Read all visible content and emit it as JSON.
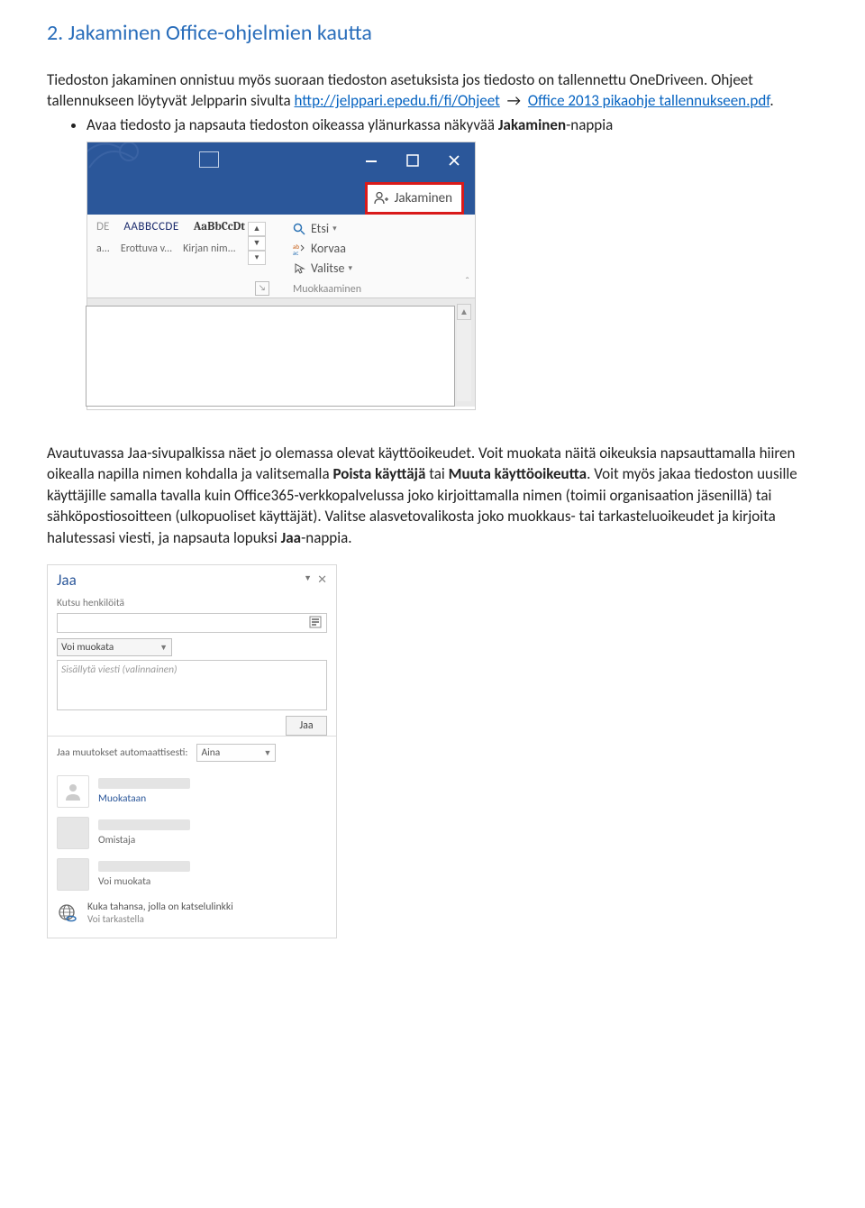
{
  "section_title": "2.  Jakaminen Office-ohjelmien kautta",
  "intro": {
    "part1": "Tiedoston jakaminen onnistuu myös suoraan tiedoston asetuksista jos tiedosto on tallennettu OneDriveen. Ohjeet tallennukseen löytyvät Jelpparin sivulta ",
    "link1": "http://jelppari.epedu.fi/fi/Ohjeet",
    "arrow": "→",
    "link2": "Office 2013 pikaohje tallennukseen.pdf",
    "part2": "."
  },
  "bullet1": {
    "t1": "Avaa tiedosto ja napsauta tiedoston oikeassa ylänurkassa näkyvää ",
    "b1": "Jakaminen",
    "t2": "-nappia"
  },
  "shot1": {
    "share_label": "Jakaminen",
    "style1_preview": "AABBCCDE",
    "style1_frag": "DE",
    "style2_preview": "AaBbCcDt",
    "style1_name": "Erottuva v...",
    "style2_name": "Kirjan nim...",
    "name_frag": "a...",
    "edit_find": "Etsi",
    "edit_replace": "Korvaa",
    "edit_select": "Valitse",
    "edit_caption": "Muokkaaminen"
  },
  "para2": {
    "t1": "Avautuvassa Jaa-sivupalkissa näet jo olemassa olevat käyttöoikeudet. Voit muokata näitä oikeuksia napsauttamalla hiiren oikealla napilla nimen kohdalla ja valitsemalla ",
    "b1": "Poista käyttäjä",
    "t2": " tai ",
    "b2": "Muuta käyttöoikeutta",
    "t3": ". Voit myös jakaa tiedoston uusille käyttäjille samalla tavalla kuin Office365-verkkopalvelussa joko kirjoittamalla nimen (toimii organisaation jäsenillä) tai sähköpostiosoitteen (ulkopuoliset käyttäjät). Valitse alasvetovalikosta joko muokkaus- tai tarkasteluoikeudet ja kirjoita halutessasi viesti, ja napsauta lopuksi ",
    "b3": "Jaa",
    "t4": "-nappia."
  },
  "shot2": {
    "title": "Jaa",
    "invite_label": "Kutsu henkilöitä",
    "perm_dropdown": "Voi muokata",
    "msg_placeholder": "Sisällytä viesti (valinnainen)",
    "share_button": "Jaa",
    "auto_label": "Jaa muutokset automaattisesti:",
    "auto_value": "Aina",
    "person1_role": "Muokataan",
    "person2_role": "Omistaja",
    "person3_role": "Voi muokata",
    "link_line1": "Kuka tahansa, jolla on katselulinkki",
    "link_line2": "Voi tarkastella"
  }
}
